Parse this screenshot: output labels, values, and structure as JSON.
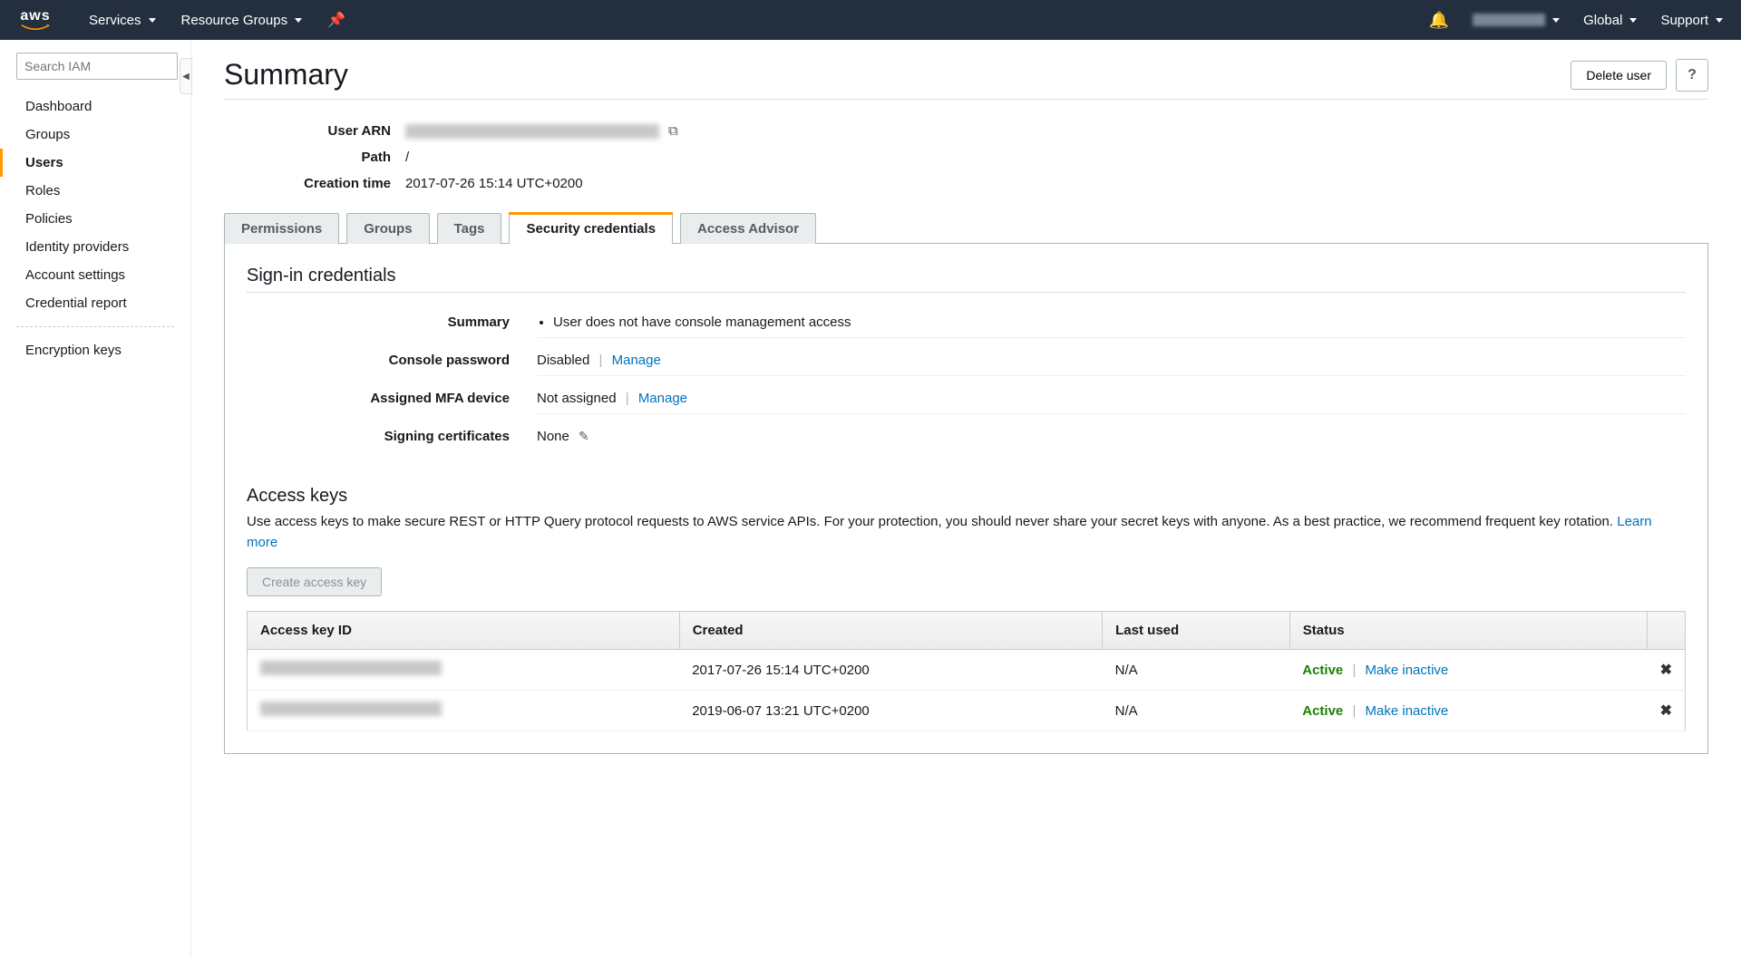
{
  "topnav": {
    "services": "Services",
    "resource_groups": "Resource Groups",
    "region": "Global",
    "support": "Support"
  },
  "sidebar": {
    "search_placeholder": "Search IAM",
    "items": [
      "Dashboard",
      "Groups",
      "Users",
      "Roles",
      "Policies",
      "Identity providers",
      "Account settings",
      "Credential report"
    ],
    "extra": [
      "Encryption keys"
    ]
  },
  "page": {
    "title": "Summary",
    "delete_user": "Delete user"
  },
  "summary": {
    "arn_label": "User ARN",
    "path_label": "Path",
    "path_value": "/",
    "creation_label": "Creation time",
    "creation_value": "2017-07-26 15:14 UTC+0200"
  },
  "tabs": [
    "Permissions",
    "Groups",
    "Tags",
    "Security credentials",
    "Access Advisor"
  ],
  "signin": {
    "heading": "Sign-in credentials",
    "summary_label": "Summary",
    "summary_bullet": "User does not have console management access",
    "console_pw_label": "Console password",
    "console_pw_value": "Disabled",
    "manage": "Manage",
    "mfa_label": "Assigned MFA device",
    "mfa_value": "Not assigned",
    "cert_label": "Signing certificates",
    "cert_value": "None"
  },
  "access_keys": {
    "heading": "Access keys",
    "desc1": "Use access keys to make secure REST or HTTP Query protocol requests to AWS service APIs. For your protection, you should never share your secret keys with anyone. As a best practice, we recommend frequent key rotation. ",
    "learn_more": "Learn more",
    "create_btn": "Create access key",
    "columns": {
      "id": "Access key ID",
      "created": "Created",
      "last": "Last used",
      "status": "Status"
    },
    "rows": [
      {
        "created": "2017-07-26 15:14 UTC+0200",
        "last": "N/A",
        "status": "Active",
        "action": "Make inactive"
      },
      {
        "created": "2019-06-07 13:21 UTC+0200",
        "last": "N/A",
        "status": "Active",
        "action": "Make inactive"
      }
    ]
  }
}
